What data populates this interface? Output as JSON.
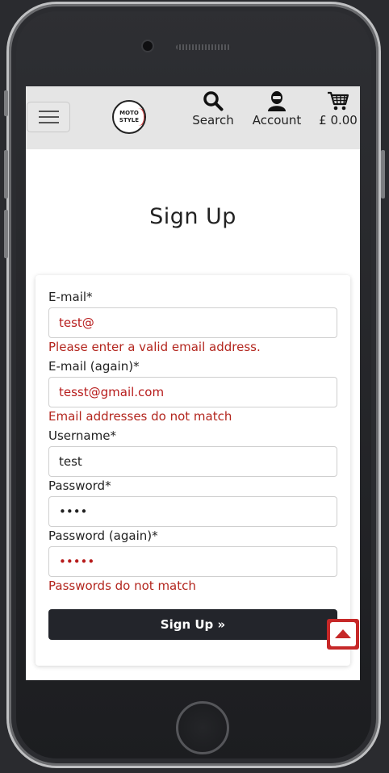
{
  "navbar": {
    "logo_text": "MOTO\nSTYLE",
    "search_label": "Search",
    "account_label": "Account",
    "cart_label": "£ 0.00"
  },
  "page": {
    "title": "Sign Up"
  },
  "form": {
    "email_label": "E-mail*",
    "email_value": "test@",
    "email_error": "Please enter a valid email address.",
    "email2_label": "E-mail (again)*",
    "email2_value": "tesst@gmail.com",
    "email2_error": "Email addresses do not match",
    "username_label": "Username*",
    "username_value": "test",
    "password_label": "Password*",
    "password_value": "••••",
    "password2_label": "Password (again)*",
    "password2_value": "•••••",
    "password_error": "Passwords do not match",
    "submit_label": "Sign Up »"
  },
  "colors": {
    "error": "#b3261e",
    "button": "#23252b",
    "navbar": "#e5e5e5",
    "back_to_top": "#c62828"
  },
  "icons": [
    "hamburger-icon",
    "search-icon",
    "account-icon",
    "cart-icon",
    "back-to-top-icon"
  ]
}
